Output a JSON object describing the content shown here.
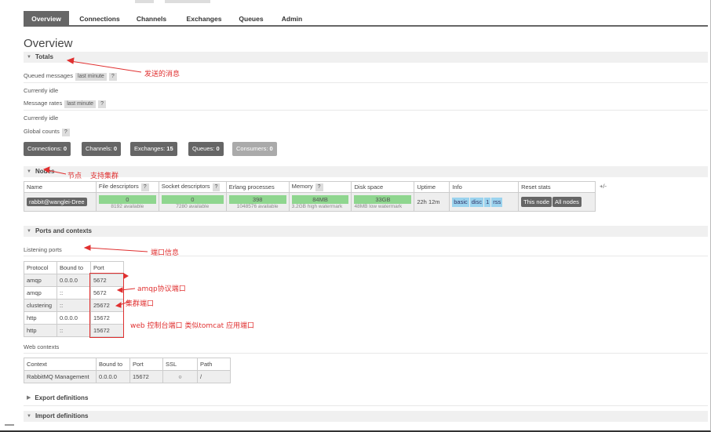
{
  "tabs": [
    "Overview",
    "Connections",
    "Channels",
    "Exchanges",
    "Queues",
    "Admin"
  ],
  "page_title": "Overview",
  "totals": {
    "section_label": "Totals",
    "queued_label": "Queued messages",
    "queued_hint": "last minute",
    "q_mark": "?",
    "idle_1": "Currently idle",
    "rates_label": "Message rates",
    "rates_hint": "last minute",
    "idle_2": "Currently idle",
    "global_label": "Global counts"
  },
  "counts": {
    "connections": {
      "label": "Connections:",
      "value": "0"
    },
    "channels": {
      "label": "Channels:",
      "value": "0"
    },
    "exchanges": {
      "label": "Exchanges:",
      "value": "15"
    },
    "queues": {
      "label": "Queues:",
      "value": "0"
    },
    "consumers": {
      "label": "Consumers:",
      "value": "0"
    }
  },
  "nodes": {
    "section_label": "Nodes",
    "headers": [
      "Name",
      "File descriptors",
      "Socket descriptors",
      "Erlang processes",
      "Memory",
      "Disk space",
      "Uptime",
      "Info",
      "Reset stats"
    ],
    "plus_minus": "+/-",
    "row": {
      "name": "rabbit@wanglei-Dree",
      "file_desc": "0",
      "file_desc_sub": "8192 available",
      "socket_desc": "0",
      "socket_desc_sub": "7280 available",
      "erlang": "398",
      "erlang_sub": "1048576 available",
      "memory": "84MB",
      "memory_sub": "3.2GB high watermark",
      "disk": "33GB",
      "disk_sub": "48MB low watermark",
      "uptime": "22h 12m",
      "info": [
        "basic",
        "disc",
        "1",
        "rss"
      ],
      "reset": [
        "This node",
        "All nodes"
      ]
    }
  },
  "ports": {
    "section_label": "Ports and contexts",
    "listening_label": "Listening ports",
    "headers": [
      "Protocol",
      "Bound to",
      "Port"
    ],
    "rows": [
      [
        "amqp",
        "0.0.0.0",
        "5672"
      ],
      [
        "amqp",
        "::",
        "5672"
      ],
      [
        "clustering",
        "::",
        "25672"
      ],
      [
        "http",
        "0.0.0.0",
        "15672"
      ],
      [
        "http",
        "::",
        "15672"
      ]
    ],
    "web_label": "Web contexts",
    "web_headers": [
      "Context",
      "Bound to",
      "Port",
      "SSL",
      "Path"
    ],
    "web_row": [
      "RabbitMQ Management",
      "0.0.0.0",
      "15672",
      "○",
      "/"
    ]
  },
  "export_label": "Export definitions",
  "import_label": "Import definitions",
  "annotations": {
    "messages": "发送的消息",
    "node": "节点",
    "cluster": "支持集群",
    "port_info": "端口信息",
    "amqp_port": "amqp协议端口",
    "cluster_port": "集群端口",
    "web_port": "web 控制台端口 类似tomcat 应用端口"
  },
  "colors": {
    "accent": "#666666",
    "bar_green": "#8fd68f",
    "info_blue": "#9bd3ee",
    "annotation": "#e03030"
  }
}
